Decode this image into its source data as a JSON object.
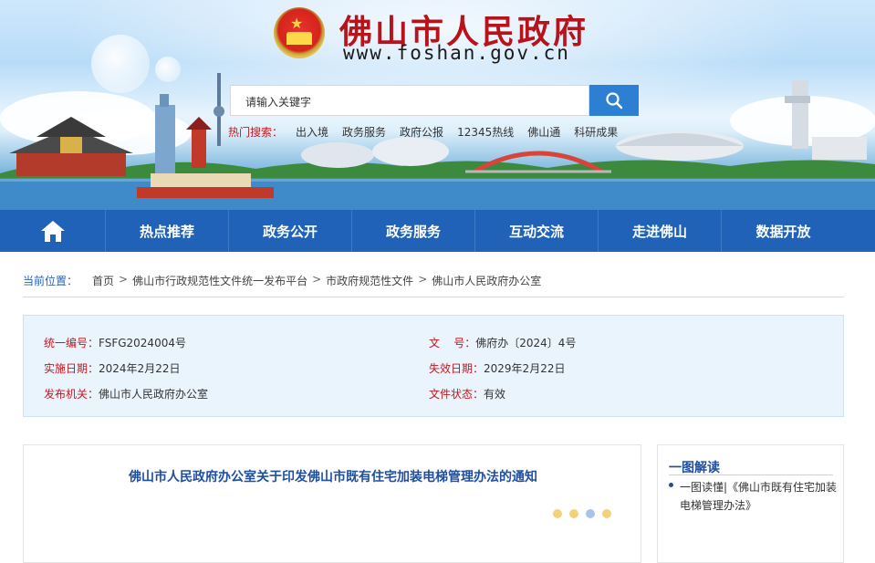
{
  "header": {
    "site_title": "佛山市人民政府",
    "site_url": "www.foshan.gov.cn",
    "emblem_icon": "national-emblem-icon",
    "search": {
      "placeholder": "请输入关键字"
    },
    "hot_search": {
      "label": "热门搜索：",
      "items": [
        "出入境",
        "政务服务",
        "政府公报",
        "12345热线",
        "佛山通",
        "科研成果"
      ]
    }
  },
  "nav": {
    "home_icon": "home-icon",
    "items": [
      "热点推荐",
      "政务公开",
      "政务服务",
      "互动交流",
      "走进佛山",
      "数据开放"
    ]
  },
  "breadcrumb": {
    "label": "当前位置：",
    "items": [
      "首页",
      "佛山市行政规范性文件统一发布平台",
      "市政府规范性文件",
      "佛山市人民政府办公室"
    ],
    "separator": ">"
  },
  "meta": {
    "serial_key": "统一编号：",
    "serial_val": "FSFG2024004号",
    "docno_key": "文    号：",
    "docno_val": "佛府办〔2024〕4号",
    "effective_key": "实施日期：",
    "effective_val": "2024年2月22日",
    "expire_key": "失效日期：",
    "expire_val": "2029年2月22日",
    "issuer_key": "发布机关：",
    "issuer_val": "佛山市人民政府办公室",
    "status_key": "文件状态：",
    "status_val": "有效"
  },
  "article": {
    "title": "佛山市人民政府办公室关于印发佛山市既有住宅加装电梯管理办法的通知"
  },
  "sidebar": {
    "title": "一图解读",
    "items": [
      "一图读懂|《佛山市既有住宅加装电梯管理办法》"
    ]
  },
  "colors": {
    "nav_blue": "#1f62b7",
    "title_red": "#b8121b",
    "link_blue": "#1f4fa0",
    "meta_bg": "#eaf4fd"
  }
}
